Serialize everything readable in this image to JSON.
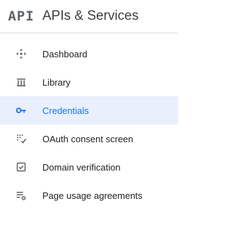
{
  "header": {
    "logo_text": "API",
    "title": "APIs & Services"
  },
  "nav": {
    "active_index": 2,
    "items": [
      {
        "label": "Dashboard",
        "icon": "dashboard-icon"
      },
      {
        "label": "Library",
        "icon": "library-icon"
      },
      {
        "label": "Credentials",
        "icon": "key-icon"
      },
      {
        "label": "OAuth consent screen",
        "icon": "oauth-consent-icon"
      },
      {
        "label": "Domain verification",
        "icon": "domain-verification-icon"
      },
      {
        "label": "Page usage agreements",
        "icon": "settings-list-icon"
      }
    ]
  },
  "colors": {
    "active_background": "#e8f0fe",
    "active_text": "#1a73e8",
    "icon_gray": "#5f6368",
    "text": "#202124"
  }
}
